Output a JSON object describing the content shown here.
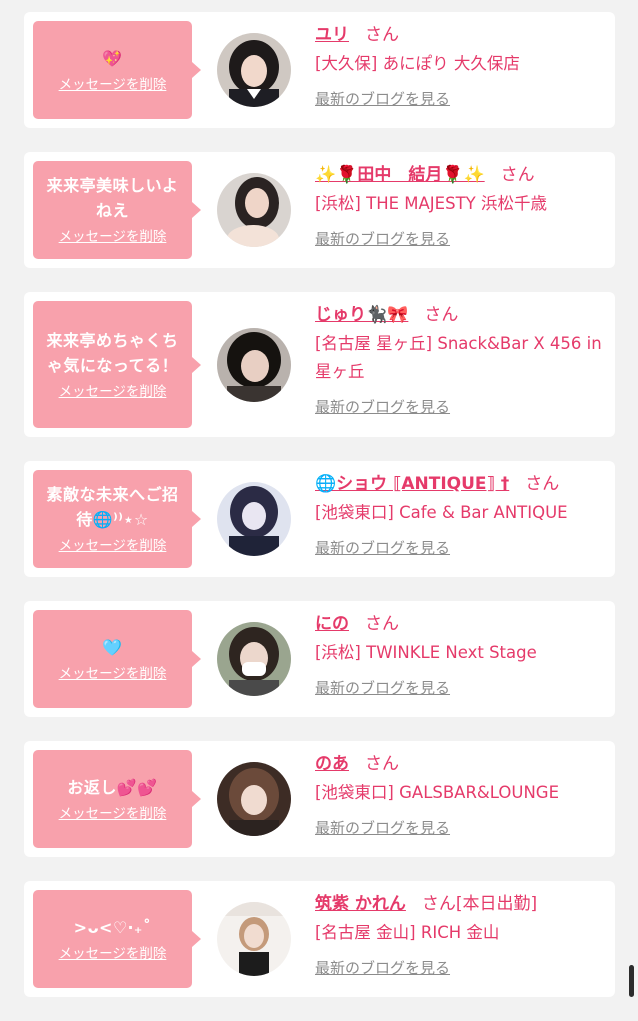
{
  "delete_label": "メッセージを削除",
  "blog_label": "最新のブログを見る",
  "cards": [
    {
      "message": "💖",
      "name": "ユリ",
      "honorific": "さん",
      "extra": "",
      "shop": "[大久保] あにぽり 大久保店",
      "avatar_icon": "avatar-dark-hair-icon"
    },
    {
      "message": "来来亭美味しいよねえ",
      "name": "✨🌹田中　結月🌹✨",
      "honorific": "さん",
      "extra": "",
      "shop": "[浜松] THE MAJESTY 浜松千歳",
      "avatar_icon": "avatar-long-hair-icon"
    },
    {
      "message": "来来亭めちゃくちゃ気になってる！",
      "name": "じゅり🐈‍⬛🎀",
      "honorific": "さん",
      "extra": "",
      "shop": "[名古屋 星ヶ丘] Snack&Bar X 456 in 星ヶ丘",
      "avatar_icon": "avatar-dark-hair-icon"
    },
    {
      "message": "素敵な未来へご招待🌐⁾⁾⋆☆",
      "name": "🌐ショウ ⟦ANTIQUE⟧ †",
      "honorific": "さん",
      "extra": "",
      "shop": "[池袋東口] Cafe & Bar ANTIQUE",
      "avatar_icon": "avatar-blue-tone-icon"
    },
    {
      "message": "🩵",
      "name": "にの",
      "honorific": "さん",
      "extra": "",
      "shop": "[浜松] TWINKLE Next Stage",
      "avatar_icon": "avatar-mask-icon"
    },
    {
      "message": "お返し💕💕",
      "name": "のあ",
      "honorific": "さん",
      "extra": "",
      "shop": "[池袋東口] GALSBAR&LOUNGE",
      "avatar_icon": "avatar-brown-hair-icon"
    },
    {
      "message": ">ᴗ<♡‧₊˚",
      "name": "筑紫 かれん",
      "honorific": "さん",
      "extra": "[本日出勤]",
      "shop": "[名古屋 金山] RICH 金山",
      "avatar_icon": "avatar-poster-icon"
    }
  ]
}
